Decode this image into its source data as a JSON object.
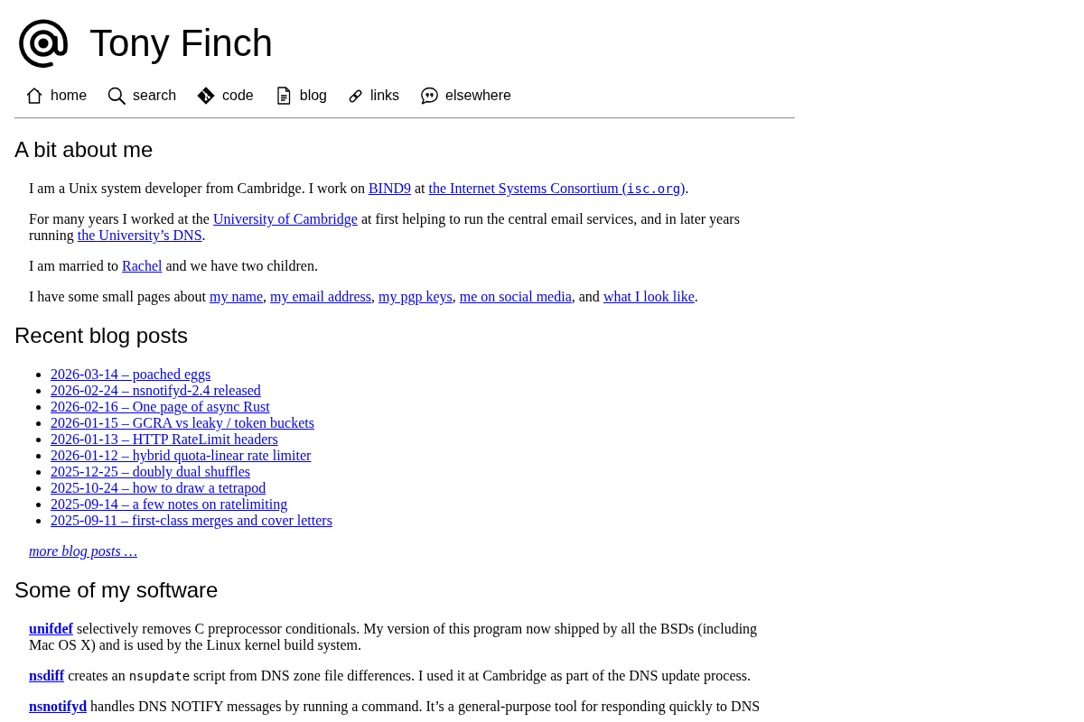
{
  "header": {
    "title": "Tony Finch"
  },
  "nav": [
    {
      "label": "home"
    },
    {
      "label": "search"
    },
    {
      "label": "code"
    },
    {
      "label": "blog"
    },
    {
      "label": "links"
    },
    {
      "label": "elsewhere"
    }
  ],
  "about": {
    "heading": "A bit about me",
    "paragraphs": [
      [
        {
          "kind": "text",
          "text": "I am a Unix system developer from Cambridge. I work on "
        },
        {
          "kind": "link",
          "text": "BIND9"
        },
        {
          "kind": "text",
          "text": " at "
        },
        {
          "kind": "link",
          "parts": [
            {
              "kind": "text",
              "text": "the Internet Systems Consortium ("
            },
            {
              "kind": "code",
              "text": "isc.org"
            },
            {
              "kind": "text",
              "text": ")"
            }
          ]
        },
        {
          "kind": "text",
          "text": "."
        }
      ],
      [
        {
          "kind": "text",
          "text": "For many years I worked at the "
        },
        {
          "kind": "link",
          "text": "University of Cambridge"
        },
        {
          "kind": "text",
          "text": " at first helping to run the central email services, and in later years running "
        },
        {
          "kind": "link",
          "text": "the University’s DNS"
        },
        {
          "kind": "text",
          "text": "."
        }
      ],
      [
        {
          "kind": "text",
          "text": "I am married to "
        },
        {
          "kind": "link",
          "text": "Rachel"
        },
        {
          "kind": "text",
          "text": " and we have two children."
        }
      ],
      [
        {
          "kind": "text",
          "text": "I have some small pages about "
        },
        {
          "kind": "link",
          "text": "my name"
        },
        {
          "kind": "text",
          "text": ", "
        },
        {
          "kind": "link",
          "text": "my email address"
        },
        {
          "kind": "text",
          "text": ", "
        },
        {
          "kind": "link",
          "text": "my pgp keys"
        },
        {
          "kind": "text",
          "text": ", "
        },
        {
          "kind": "link",
          "text": "me on social media"
        },
        {
          "kind": "text",
          "text": ", and "
        },
        {
          "kind": "link",
          "text": "what I look like"
        },
        {
          "kind": "text",
          "text": "."
        }
      ]
    ]
  },
  "blog": {
    "heading": "Recent blog posts",
    "posts": [
      "2026-03-14 – poached eggs",
      "2026-02-24 – nsnotifyd-2.4 released",
      "2026-02-16 – One page of async Rust",
      "2026-01-15 – GCRA vs leaky / token buckets",
      "2026-01-13 – HTTP RateLimit headers",
      "2026-01-12 – hybrid quota-linear rate limiter",
      "2025-12-25 – doubly dual shuffles",
      "2025-10-24 – how to draw a tetrapod",
      "2025-09-14 – a few notes on ratelimiting",
      "2025-09-11 – first-class merges and cover letters"
    ],
    "more_link": "more blog posts …"
  },
  "software": {
    "heading": "Some of my software",
    "items": [
      [
        {
          "kind": "strong_link",
          "text": "unifdef"
        },
        {
          "kind": "text",
          "text": " selectively removes C preprocessor conditionals. My version of this program now shipped by all the BSDs (including Mac OS X) and is used by the Linux kernel build system."
        }
      ],
      [
        {
          "kind": "strong_link",
          "text": "nsdiff"
        },
        {
          "kind": "text",
          "text": " creates an "
        },
        {
          "kind": "code",
          "text": "nsupdate"
        },
        {
          "kind": "text",
          "text": " script from DNS zone file differences. I used it at Cambridge as part of the DNS update process."
        }
      ],
      [
        {
          "kind": "strong_link",
          "text": "nsnotifyd"
        },
        {
          "kind": "text",
          "text": " handles DNS NOTIFY messages by running a command. It’s a general-purpose tool for responding quickly to DNS"
        }
      ]
    ]
  }
}
